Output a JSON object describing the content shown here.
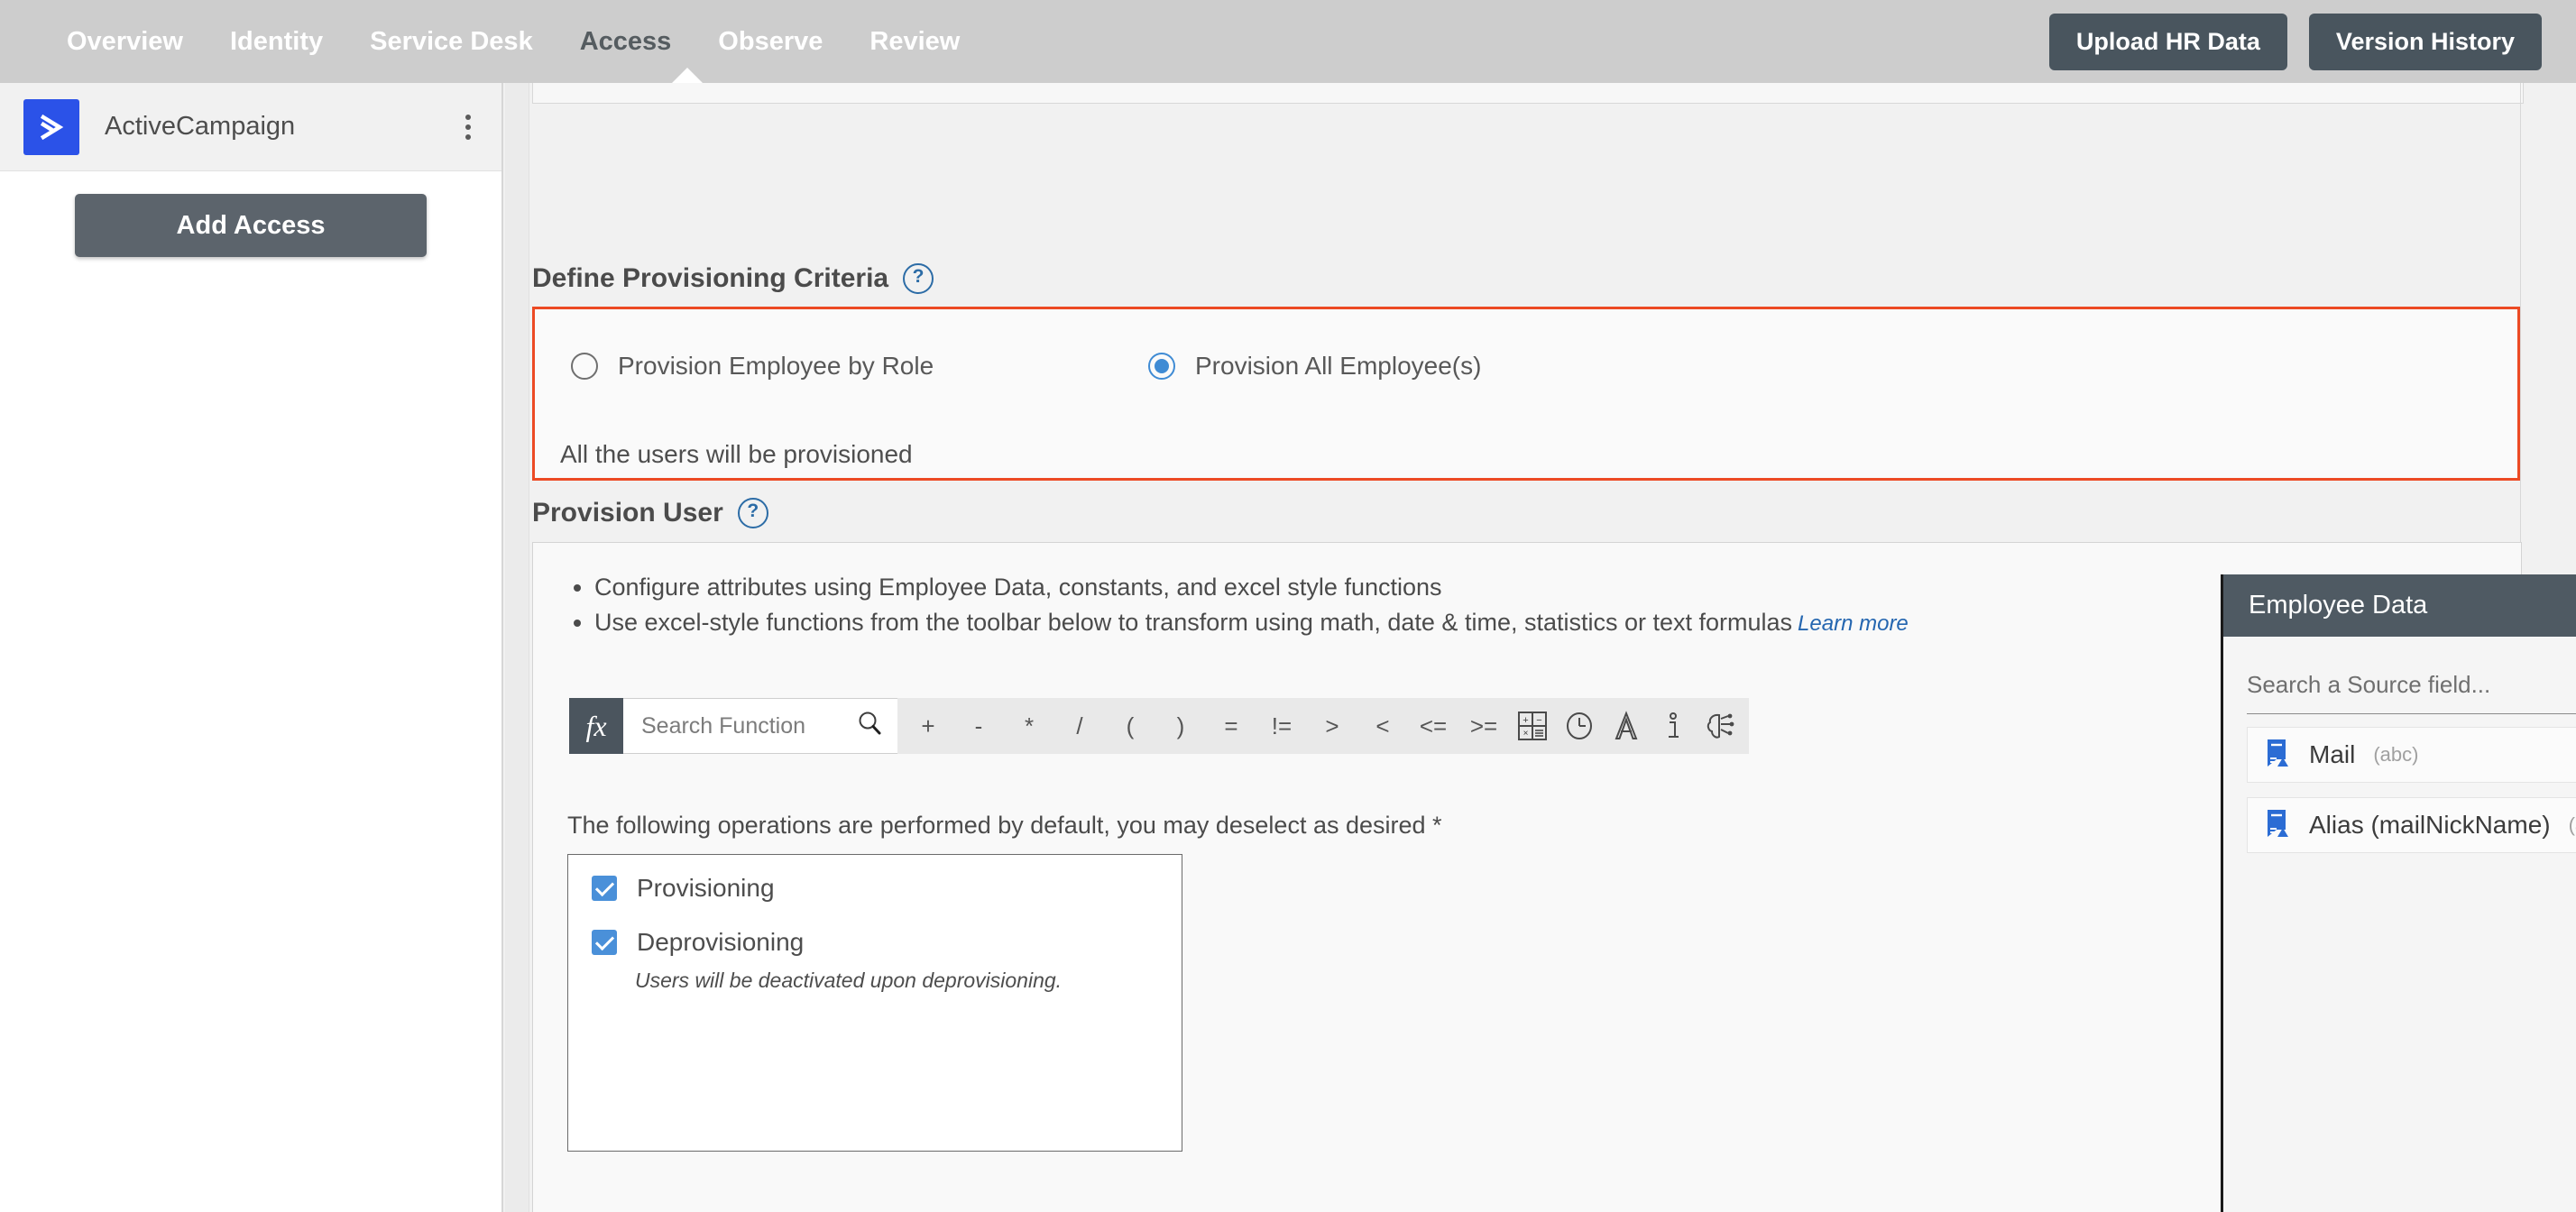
{
  "topnav": {
    "items": [
      {
        "label": "Overview",
        "active": false
      },
      {
        "label": "Identity",
        "active": false
      },
      {
        "label": "Service Desk",
        "active": false
      },
      {
        "label": "Access",
        "active": true
      },
      {
        "label": "Observe",
        "active": false
      },
      {
        "label": "Review",
        "active": false
      }
    ],
    "upload_button": "Upload HR Data",
    "version_button": "Version History",
    "background": "#cdcdcd",
    "button_color": "#49555e"
  },
  "sidebar": {
    "app_name": "ActiveCampaign",
    "logo_color": "#2b52e8",
    "menu_icon": "kebab-menu-icon",
    "add_access_button": "Add Access"
  },
  "criteria": {
    "title": "Define Provisioning Criteria",
    "help_icon": "help-circle-icon",
    "border_color": "#ec4a24",
    "options": [
      {
        "label": "Provision Employee by Role",
        "selected": false
      },
      {
        "label": "Provision All Employee(s)",
        "selected": true
      }
    ],
    "note": "All the users will be provisioned",
    "accent": "#3f8bd4"
  },
  "provision_user": {
    "title": "Provision User",
    "help_icon": "help-circle-icon",
    "bullets": [
      "Configure attributes using Employee Data, constants, and excel style functions",
      "Use excel-style functions from the toolbar below to transform using math, date & time, statistics or text formulas"
    ],
    "learn_more": "Learn more",
    "toolbar": {
      "fx_label": "fx",
      "search_placeholder": "Search Function",
      "search_icon": "search-icon",
      "operators": [
        "+",
        "-",
        "*",
        "/",
        "(",
        ")",
        "=",
        "!=",
        ">",
        "<",
        "<=",
        ">="
      ],
      "icons": [
        {
          "name": "math-functions-icon"
        },
        {
          "name": "clock-icon"
        },
        {
          "name": "text-format-icon"
        },
        {
          "name": "info-icon"
        },
        {
          "name": "ai-brain-icon"
        }
      ]
    },
    "operations_note": "The following operations are performed by default, you may deselect as desired *",
    "operations": [
      {
        "label": "Provisioning",
        "checked": true
      },
      {
        "label": "Deprovisioning",
        "checked": true
      }
    ],
    "operations_hint": "Users will be deactivated upon deprovisioning."
  },
  "employee_data": {
    "title": "Employee Data",
    "search_placeholder": "Search a Source field...",
    "fields": [
      {
        "name": "Mail",
        "type": "(abc)",
        "icon": "source-field-icon"
      },
      {
        "name": "Alias (mailNickName)",
        "type": "(abc)",
        "icon": "source-field-icon"
      }
    ],
    "scrollbar": "vertical-scrollbar"
  }
}
